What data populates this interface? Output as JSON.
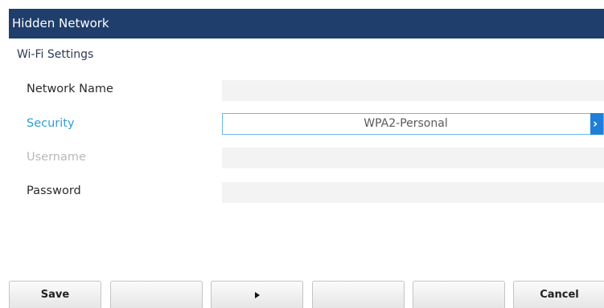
{
  "header": {
    "title": "Hidden Network"
  },
  "section": {
    "title": "Wi-Fi Settings"
  },
  "form": {
    "network_name": {
      "label": "Network Name",
      "value": ""
    },
    "security": {
      "label": "Security",
      "value": "WPA2-Personal",
      "icon": "chevron-right-icon"
    },
    "username": {
      "label": "Username",
      "value": ""
    },
    "password": {
      "label": "Password",
      "value": ""
    }
  },
  "softkeys": {
    "save_label": "Save",
    "next_icon": "play-icon",
    "cancel_label": "Cancel"
  },
  "colors": {
    "header_bg": "#1f3e6b",
    "active_label": "#2c9ed6",
    "select_arrow": "#1f7ed8",
    "disabled_label": "#b8b8b8"
  }
}
